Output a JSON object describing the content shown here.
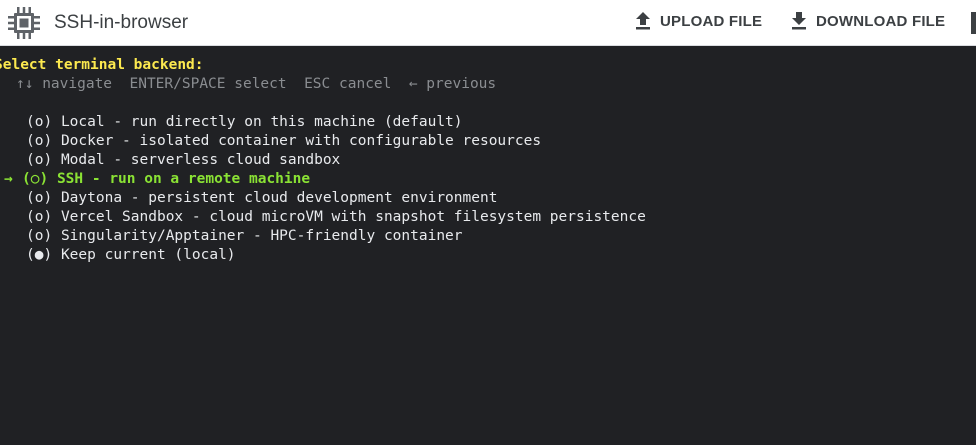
{
  "header": {
    "title": "SSH-in-browser",
    "upload_label": "UPLOAD FILE",
    "download_label": "DOWNLOAD FILE",
    "app_icon": "chip-icon",
    "upload_icon": "upload-icon",
    "download_icon": "download-icon"
  },
  "terminal": {
    "prompt": "Select terminal backend:",
    "hint": "↑↓ navigate  ENTER/SPACE select  ESC cancel  ← previous",
    "cursor": "→",
    "options": [
      {
        "marker": "(o)",
        "text": "Local - run directly on this machine (default)"
      },
      {
        "marker": "(o)",
        "text": "Docker - isolated container with configurable resources"
      },
      {
        "marker": "(o)",
        "text": "Modal - serverless cloud sandbox"
      },
      {
        "marker": "(○)",
        "text": "SSH - run on a remote machine"
      },
      {
        "marker": "(o)",
        "text": "Daytona - persistent cloud development environment"
      },
      {
        "marker": "(o)",
        "text": "Vercel Sandbox - cloud microVM with snapshot filesystem persistence"
      },
      {
        "marker": "(o)",
        "text": "Singularity/Apptainer - HPC-friendly container"
      },
      {
        "marker": "(●)",
        "text": "Keep current (local)"
      }
    ]
  },
  "colors": {
    "terminal_bg": "#202124",
    "prompt": "#fce94f",
    "selected": "#8ae234",
    "hint": "#8a8d91",
    "text": "#e8eaed"
  }
}
